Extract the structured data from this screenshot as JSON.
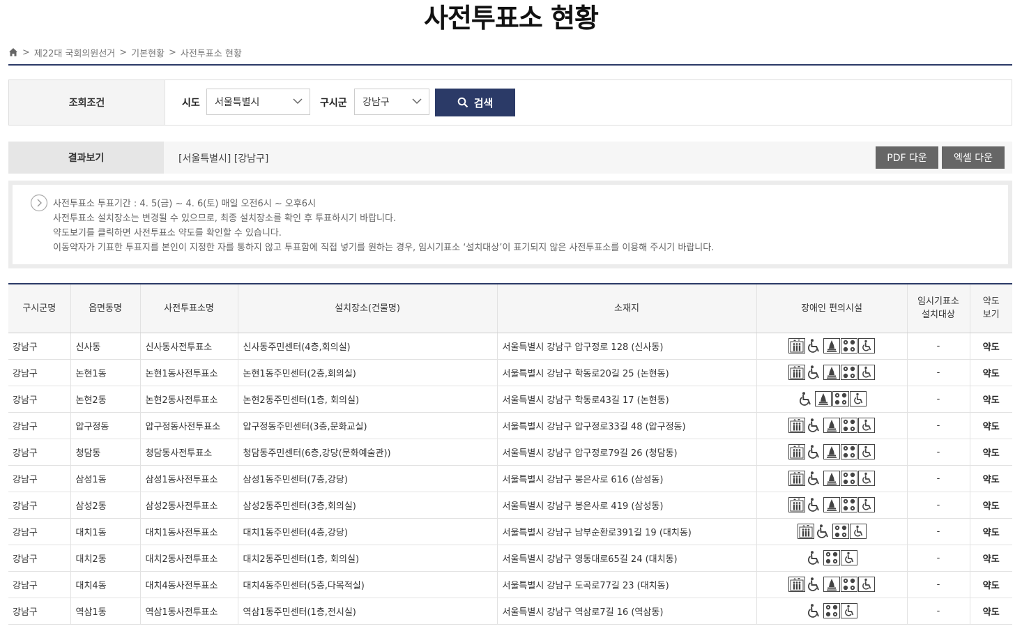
{
  "page_title": "사전투표소 현황",
  "breadcrumb": [
    "제22대 국회의원선거",
    "기본현황",
    "사전투표소 현황"
  ],
  "search": {
    "section_label": "조회조건",
    "sido_label": "시도",
    "sido_value": "서울특별시",
    "sigungu_label": "구시군",
    "sigungu_value": "강남구",
    "button_label": "검색"
  },
  "result": {
    "section_label": "결과보기",
    "text": "[서울특별시] [강남구]",
    "pdf_label": "PDF 다운",
    "excel_label": "엑셀 다운"
  },
  "notice": [
    "사전투표소 투표기간 : 4. 5(금) ~ 4. 6(토) 매일 오전6시 ~ 오후6시",
    "사전투표소 설치장소는 변경될 수 있으므로, 최종 설치장소를 확인 후 투표하시기 바랍니다.",
    "약도보기를 클릭하면 사전투표소 약도를 확인할 수 있습니다.",
    "이동약자가 기표한 투표지를 본인이 지정한 자를 통하지 않고 투표함에 직접 넣기를 원하는 경우, 임시기표소 ‘설치대상’이 표기되지 않은 사전투표소를 이용해 주시기 바랍니다."
  ],
  "table": {
    "headers": {
      "district": "구시군명",
      "dong": "읍면동명",
      "station": "사전투표소명",
      "building": "설치장소(건물명)",
      "address": "소재지",
      "facilities": "장애인 편의시설",
      "temp_booth_1": "임시기표소",
      "temp_booth_2": "설치대상",
      "map_1": "약도",
      "map_2": "보기"
    },
    "rows": [
      {
        "district": "강남구",
        "dong": "신사동",
        "station": "신사동사전투표소",
        "building": "신사동주민센터(4층,회의실)",
        "address": "서울특별시 강남구 압구정로 128 (신사동)",
        "facilities": [
          "elevator-icon",
          "wheelchair-icon",
          "bell-icon",
          "braille-icon",
          "ramp-icon"
        ],
        "temp": "-",
        "map": "약도"
      },
      {
        "district": "강남구",
        "dong": "논현1동",
        "station": "논현1동사전투표소",
        "building": "논현1동주민센터(2층,회의실)",
        "address": "서울특별시 강남구 학동로20길 25 (논현동)",
        "facilities": [
          "elevator-icon",
          "wheelchair-icon",
          "bell-icon",
          "braille-icon",
          "ramp-icon"
        ],
        "temp": "-",
        "map": "약도"
      },
      {
        "district": "강남구",
        "dong": "논현2동",
        "station": "논현2동사전투표소",
        "building": "논현2동주민센터(1층, 회의실)",
        "address": "서울특별시 강남구 학동로43길 17 (논현동)",
        "facilities": [
          "wheelchair-icon",
          "bell-icon",
          "braille-icon",
          "ramp-icon"
        ],
        "temp": "-",
        "map": "약도"
      },
      {
        "district": "강남구",
        "dong": "압구정동",
        "station": "압구정동사전투표소",
        "building": "압구정동주민센터(3층,문화교실)",
        "address": "서울특별시 강남구 압구정로33길 48 (압구정동)",
        "facilities": [
          "elevator-icon",
          "wheelchair-icon",
          "bell-icon",
          "braille-icon",
          "ramp-icon"
        ],
        "temp": "-",
        "map": "약도"
      },
      {
        "district": "강남구",
        "dong": "청담동",
        "station": "청담동사전투표소",
        "building": "청담동주민센터(6층,강당(문화예술관))",
        "address": "서울특별시 강남구 압구정로79길 26 (청담동)",
        "facilities": [
          "elevator-icon",
          "wheelchair-icon",
          "bell-icon",
          "braille-icon",
          "ramp-icon"
        ],
        "temp": "-",
        "map": "약도"
      },
      {
        "district": "강남구",
        "dong": "삼성1동",
        "station": "삼성1동사전투표소",
        "building": "삼성1동주민센터(7층,강당)",
        "address": "서울특별시 강남구 봉은사로 616 (삼성동)",
        "facilities": [
          "elevator-icon",
          "wheelchair-icon",
          "bell-icon",
          "braille-icon",
          "ramp-icon"
        ],
        "temp": "-",
        "map": "약도"
      },
      {
        "district": "강남구",
        "dong": "삼성2동",
        "station": "삼성2동사전투표소",
        "building": "삼성2동주민센터(3층,회의실)",
        "address": "서울특별시 강남구 봉은사로 419 (삼성동)",
        "facilities": [
          "elevator-icon",
          "wheelchair-icon",
          "bell-icon",
          "braille-icon",
          "ramp-icon"
        ],
        "temp": "-",
        "map": "약도"
      },
      {
        "district": "강남구",
        "dong": "대치1동",
        "station": "대치1동사전투표소",
        "building": "대치1동주민센터(4층,강당)",
        "address": "서울특별시 강남구 남부순환로391길 19 (대치동)",
        "facilities": [
          "elevator-icon",
          "wheelchair-icon",
          "braille-icon",
          "ramp-icon"
        ],
        "temp": "-",
        "map": "약도"
      },
      {
        "district": "강남구",
        "dong": "대치2동",
        "station": "대치2동사전투표소",
        "building": "대치2동주민센터(1층, 회의실)",
        "address": "서울특별시 강남구 영동대로65길 24 (대치동)",
        "facilities": [
          "wheelchair-icon",
          "braille-icon",
          "ramp-icon"
        ],
        "temp": "-",
        "map": "약도"
      },
      {
        "district": "강남구",
        "dong": "대치4동",
        "station": "대치4동사전투표소",
        "building": "대치4동주민센터(5층,다목적실)",
        "address": "서울특별시 강남구 도곡로77길 23 (대치동)",
        "facilities": [
          "elevator-icon",
          "wheelchair-icon",
          "bell-icon",
          "braille-icon",
          "ramp-icon"
        ],
        "temp": "-",
        "map": "약도"
      },
      {
        "district": "강남구",
        "dong": "역삼1동",
        "station": "역삼1동사전투표소",
        "building": "역삼1동주민센터(1층,전시실)",
        "address": "서울특별시 강남구 역삼로7길 16 (역삼동)",
        "facilities": [
          "wheelchair-icon",
          "braille-icon",
          "ramp-icon"
        ],
        "temp": "-",
        "map": "약도"
      }
    ]
  },
  "colors": {
    "accent": "#2b3a67",
    "download_button": "#666666"
  }
}
